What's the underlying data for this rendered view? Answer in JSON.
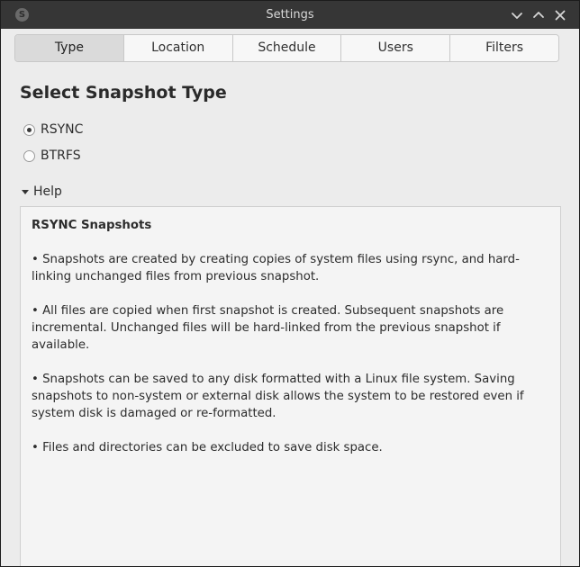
{
  "window": {
    "title": "Settings",
    "app_icon_glyph": "S"
  },
  "tabs": [
    {
      "label": "Type",
      "active": true
    },
    {
      "label": "Location",
      "active": false
    },
    {
      "label": "Schedule",
      "active": false
    },
    {
      "label": "Users",
      "active": false
    },
    {
      "label": "Filters",
      "active": false
    }
  ],
  "main": {
    "heading": "Select Snapshot Type",
    "options": [
      {
        "label": "RSYNC",
        "checked": true
      },
      {
        "label": "BTRFS",
        "checked": false
      }
    ],
    "help": {
      "expander_label": "Help",
      "title": "RSYNC Snapshots",
      "paragraphs": [
        "• Snapshots are created by creating copies of system files using rsync, and hard-linking unchanged files from previous snapshot.",
        "• All files are copied when first snapshot is created. Subsequent snapshots are incremental. Unchanged files will be hard-linked from the previous snapshot if available.",
        "• Snapshots can be saved to any disk formatted with a Linux file system. Saving snapshots to non-system or external disk allows the system to be restored even if system disk is damaged or re-formatted.",
        "• Files and directories can be excluded to save disk space."
      ]
    }
  },
  "icons": {
    "minimize": "chevron-down-icon",
    "maximize": "chevron-up-icon",
    "close": "close-icon"
  },
  "colors": {
    "titlebar": "#363636",
    "background": "#ececec",
    "active_tab": "#dadada"
  }
}
